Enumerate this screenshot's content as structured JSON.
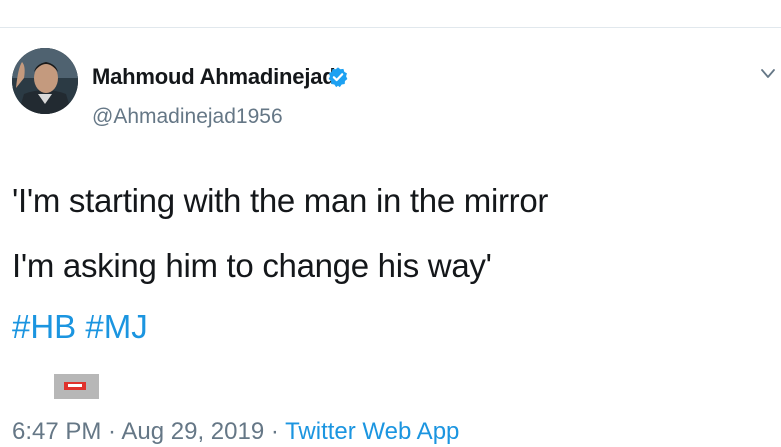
{
  "tweet": {
    "author": {
      "name": "Mahmoud Ahmadinejad",
      "handle": "@Ahmadinejad1956",
      "verified": true,
      "avatar_icon": "profile-photo"
    },
    "text_lines": [
      "'I'm starting with the man in the mirror",
      "I'm asking him to change his way'"
    ],
    "hashtags": [
      "#HB",
      "#MJ"
    ],
    "timestamp": "6:47 PM · Aug 29, 2019 · ",
    "source": "Twitter Web App",
    "colors": {
      "link": "#1b95e0",
      "secondary_text": "#657786",
      "primary_text": "#14171a",
      "verified_badge": "#1da1f2"
    }
  }
}
